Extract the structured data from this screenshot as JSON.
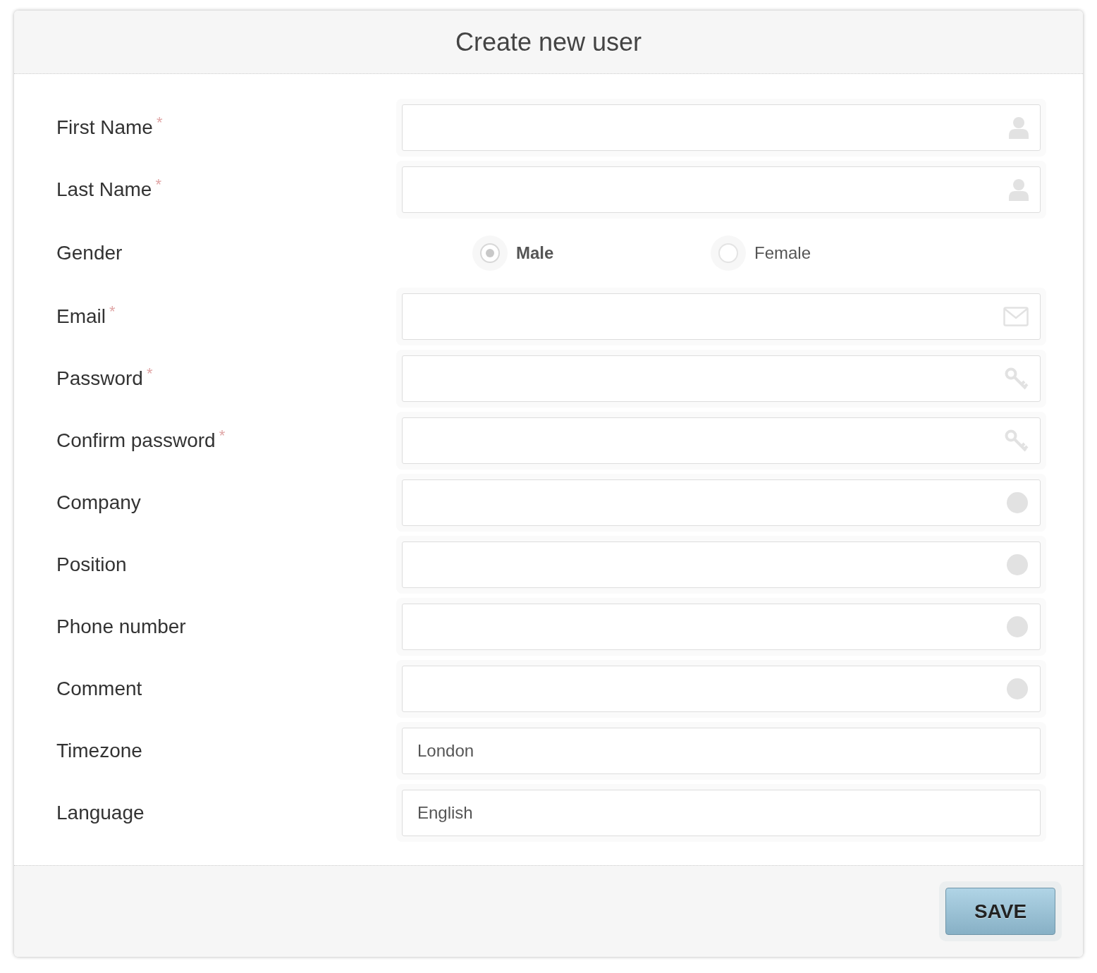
{
  "title": "Create new user",
  "fields": [
    {
      "kind": "name",
      "label": "First Name",
      "required": "*"
    },
    {
      "kind": "name",
      "label": "Last Name",
      "required": "*"
    },
    {
      "kind": "radio",
      "label": "Gender",
      "options": [
        {
          "label": "Male",
          "selected": true
        },
        {
          "label": "Female",
          "selected": false
        }
      ]
    },
    {
      "kind": "email",
      "label": "Email",
      "required": "*"
    },
    {
      "kind": "password",
      "label": "Password",
      "required": "*"
    },
    {
      "kind": "password",
      "label": "Confirm password",
      "required": "*"
    },
    {
      "kind": "text",
      "label": "Company"
    },
    {
      "kind": "text",
      "label": "Position"
    },
    {
      "kind": "text",
      "label": "Phone number"
    },
    {
      "kind": "text",
      "label": "Comment"
    },
    {
      "kind": "select",
      "label": "Timezone",
      "value": "London"
    },
    {
      "kind": "select",
      "label": "Language",
      "value": "English"
    }
  ],
  "save_button": "SAVE"
}
